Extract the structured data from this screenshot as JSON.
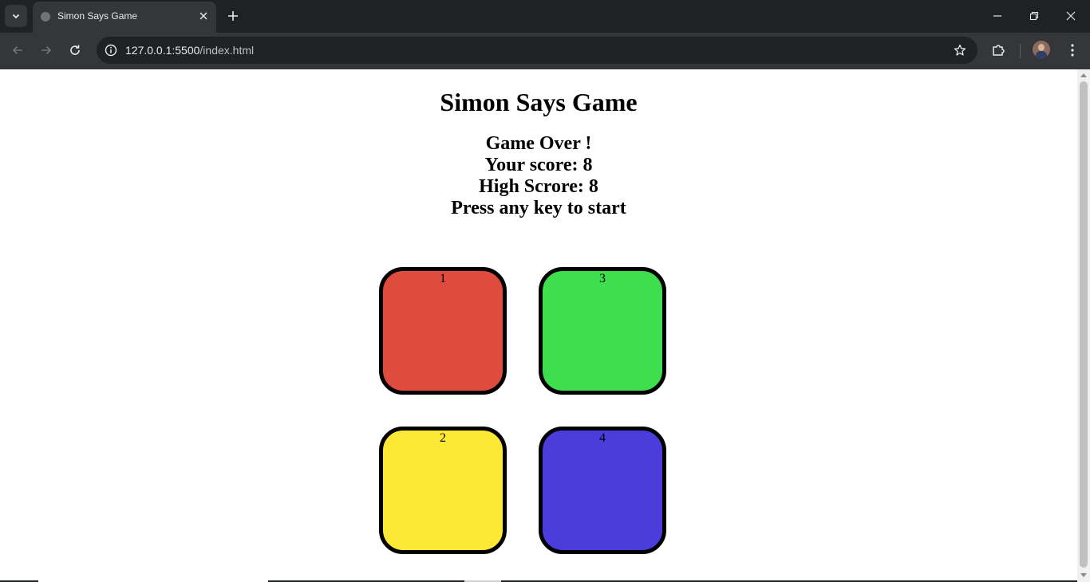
{
  "browser": {
    "tab_title": "Simon Says Game",
    "url_host": "127.0.0.1:5500",
    "url_path": "/index.html"
  },
  "page": {
    "title": "Simon Says Game",
    "status_lines": [
      "Game Over !",
      "Your score: 8",
      "High Scrore: 8",
      "Press any key to start"
    ]
  },
  "buttons": [
    {
      "label": "1",
      "color": "#df4c3e",
      "name": "red"
    },
    {
      "label": "3",
      "color": "#3ede4e",
      "name": "green"
    },
    {
      "label": "2",
      "color": "#fde935",
      "name": "yellow"
    },
    {
      "label": "4",
      "color": "#4b3ddc",
      "name": "purple"
    }
  ],
  "colors": {
    "browser_chrome": "#202124",
    "toolbar": "#35363a",
    "page_background": "#ffffff"
  }
}
